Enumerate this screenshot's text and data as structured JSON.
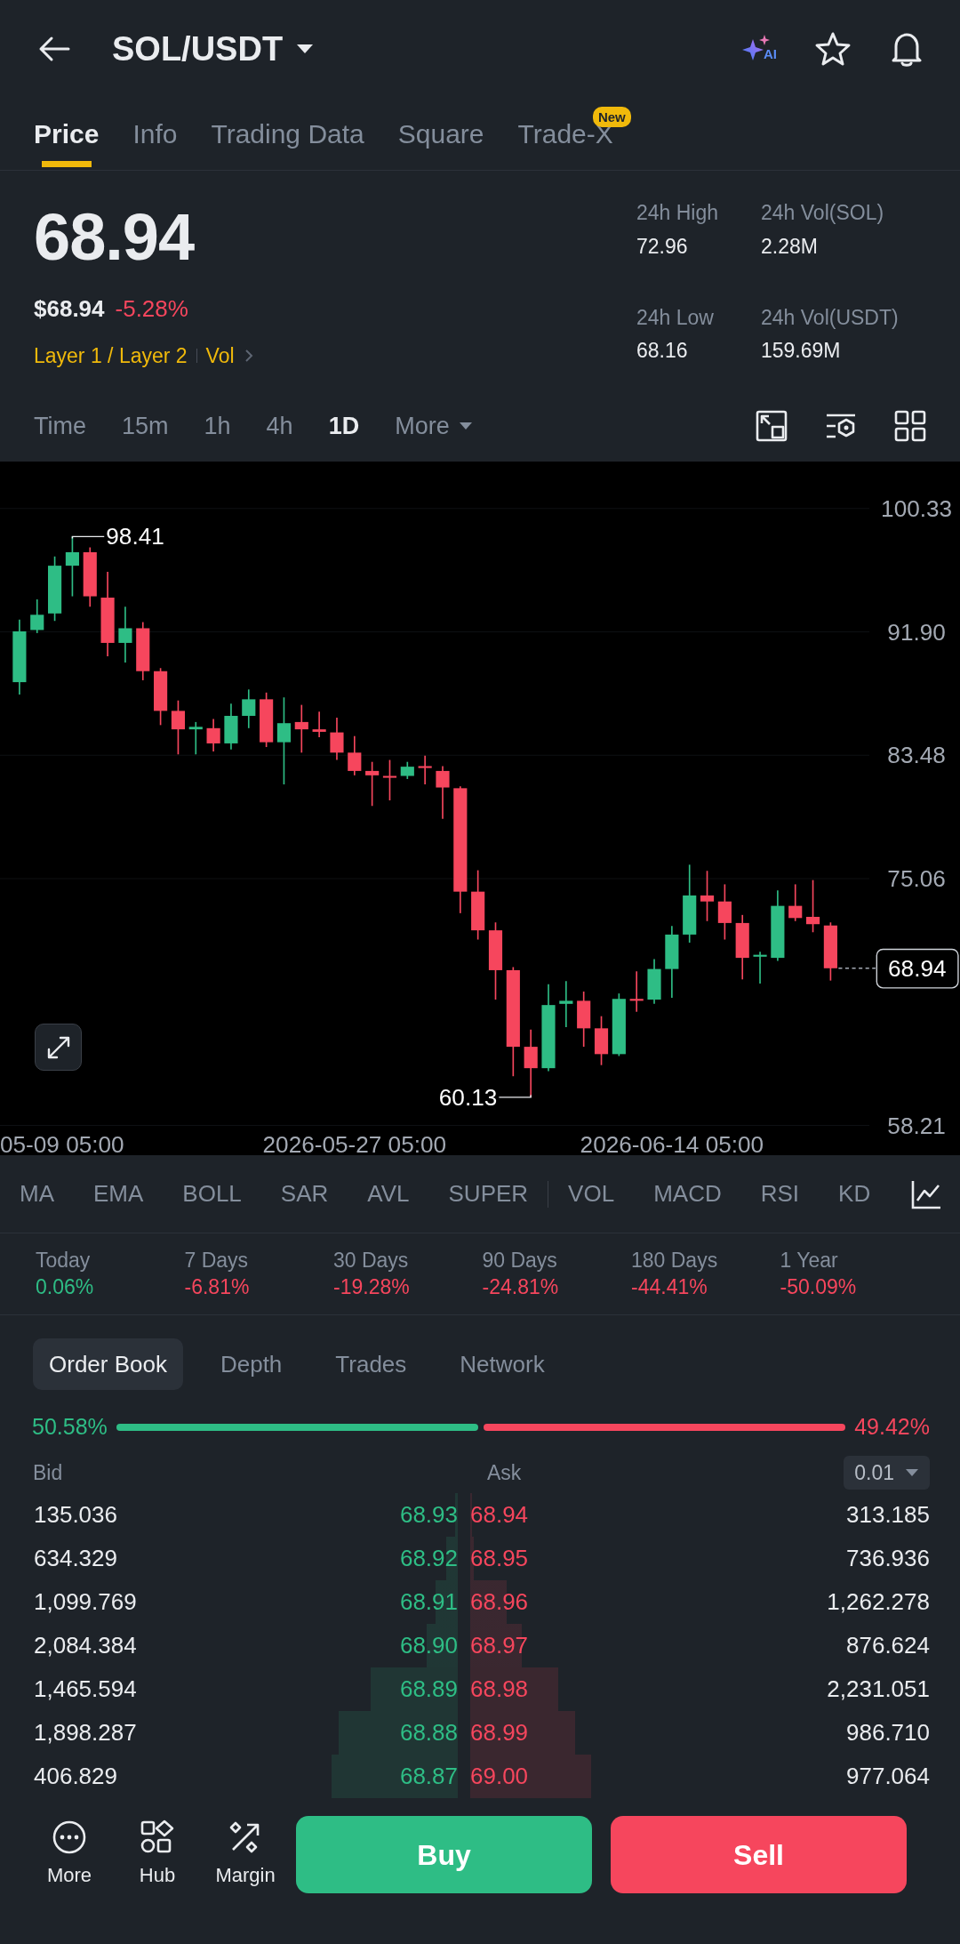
{
  "header": {
    "title": "SOL/USDT",
    "ai_label": "AI"
  },
  "tabs": [
    {
      "label": "Price",
      "selected": true
    },
    {
      "label": "Info",
      "selected": false
    },
    {
      "label": "Trading Data",
      "selected": false
    },
    {
      "label": "Square",
      "selected": false
    },
    {
      "label": "Trade-X",
      "selected": false,
      "badge": "New"
    }
  ],
  "price": {
    "last": "68.94",
    "usd": "$68.94",
    "change": "-5.28%",
    "tags": [
      "Layer 1 / Layer 2",
      "Vol"
    ]
  },
  "stats": [
    {
      "label": "24h High",
      "value": "72.96"
    },
    {
      "label": "24h Vol(SOL)",
      "value": "2.28M"
    },
    {
      "label": "24h Low",
      "value": "68.16"
    },
    {
      "label": "24h Vol(USDT)",
      "value": "159.69M"
    }
  ],
  "intervals": [
    {
      "label": "Time",
      "selected": false,
      "kind": "plain"
    },
    {
      "label": "15m",
      "selected": false,
      "kind": "plain"
    },
    {
      "label": "1h",
      "selected": false,
      "kind": "plain"
    },
    {
      "label": "4h",
      "selected": false,
      "kind": "plain"
    },
    {
      "label": "1D",
      "selected": true,
      "kind": "plain"
    },
    {
      "label": "More",
      "selected": false,
      "kind": "dropdown"
    }
  ],
  "chart": {
    "edge_time_label": "05-09 05:00",
    "high_label": "98.41",
    "low_label": "60.13",
    "last_price": "68.94",
    "chart_data": {
      "type": "candlestick",
      "categories": [
        null,
        null,
        null,
        null,
        null,
        null,
        null,
        null,
        null,
        null,
        null,
        null,
        null,
        null,
        null,
        null,
        null,
        null,
        null,
        "2026-05-27 05:00",
        null,
        null,
        null,
        null,
        null,
        null,
        null,
        null,
        null,
        null,
        null,
        null,
        null,
        null,
        null,
        null,
        null,
        "2026-06-14 05:00",
        null,
        null,
        null,
        null,
        null,
        null,
        null,
        null,
        null
      ],
      "ohlc": [
        [
          88.47,
          92.74,
          87.63,
          91.94
        ],
        [
          92.03,
          94.12,
          91.82,
          93.07
        ],
        [
          93.16,
          97.05,
          92.65,
          96.42
        ],
        [
          96.42,
          98.41,
          94.33,
          97.34
        ],
        [
          97.34,
          97.67,
          93.62,
          94.33
        ],
        [
          94.24,
          96.0,
          90.23,
          91.15
        ],
        [
          91.15,
          93.62,
          89.81,
          92.15
        ],
        [
          92.15,
          92.57,
          88.6,
          89.22
        ],
        [
          89.22,
          89.43,
          85.54,
          86.51
        ],
        [
          86.51,
          87.22,
          83.54,
          85.25
        ],
        [
          85.25,
          85.75,
          83.54,
          85.42
        ],
        [
          85.33,
          85.96,
          83.74,
          84.29
        ],
        [
          84.29,
          87.01,
          83.87,
          86.17
        ],
        [
          86.17,
          87.97,
          85.33,
          87.3
        ],
        [
          87.3,
          87.76,
          84.04,
          84.37
        ],
        [
          84.37,
          87.43,
          81.49,
          85.67
        ],
        [
          85.75,
          86.92,
          83.66,
          85.25
        ],
        [
          85.25,
          86.46,
          84.71,
          85.08
        ],
        [
          85.04,
          86.05,
          83.16,
          83.66
        ],
        [
          83.66,
          84.79,
          82.11,
          82.41
        ],
        [
          82.41,
          83.03,
          80.02,
          82.11
        ],
        [
          82.07,
          83.16,
          80.4,
          81.95
        ],
        [
          82.07,
          83.03,
          81.86,
          82.7
        ],
        [
          82.74,
          83.45,
          81.49,
          82.61
        ],
        [
          82.41,
          82.74,
          79.14,
          81.28
        ],
        [
          81.23,
          81.36,
          72.7,
          74.17
        ],
        [
          74.17,
          75.63,
          70.9,
          71.53
        ],
        [
          71.53,
          72.07,
          66.8,
          68.81
        ],
        [
          68.81,
          69.02,
          61.57,
          63.58
        ],
        [
          63.58,
          64.75,
          60.13,
          62.12
        ],
        [
          62.12,
          67.85,
          61.91,
          66.43
        ],
        [
          66.51,
          68.06,
          64.92,
          66.72
        ],
        [
          66.72,
          67.35,
          63.58,
          64.84
        ],
        [
          64.84,
          65.67,
          62.33,
          63.08
        ],
        [
          63.08,
          67.22,
          62.95,
          66.85
        ],
        [
          66.85,
          68.73,
          65.97,
          66.72
        ],
        [
          66.8,
          69.56,
          66.51,
          68.89
        ],
        [
          68.89,
          71.82,
          66.93,
          71.24
        ],
        [
          71.24,
          76.01,
          70.69,
          73.91
        ],
        [
          73.91,
          75.59,
          72.16,
          73.5
        ],
        [
          73.5,
          74.67,
          70.9,
          72.03
        ],
        [
          72.03,
          72.58,
          68.18,
          69.65
        ],
        [
          69.73,
          70.07,
          67.89,
          69.86
        ],
        [
          69.65,
          74.25,
          69.44,
          73.2
        ],
        [
          73.2,
          74.67,
          72.16,
          72.37
        ],
        [
          72.45,
          74.96,
          71.4,
          71.95
        ],
        [
          71.86,
          72.07,
          68.1,
          68.94
        ]
      ],
      "ylim": [
        56.18,
        103.53
      ],
      "grid": true,
      "yticks": [
        {
          "value": 100.33,
          "label": "100.33"
        },
        {
          "value": 91.9,
          "label": "91.90"
        },
        {
          "value": 83.48,
          "label": "83.48"
        },
        {
          "value": 75.06,
          "label": "75.06"
        },
        {
          "value": 58.21,
          "label": "58.21"
        }
      ]
    }
  },
  "main_indicators": [
    "MA",
    "EMA",
    "BOLL",
    "SAR",
    "AVL",
    "SUPER"
  ],
  "sub_indicators": [
    "VOL",
    "MACD",
    "RSI",
    "KD"
  ],
  "performance": [
    {
      "period": "Today",
      "change": "0.06%",
      "color": "#2ebd85"
    },
    {
      "period": "7 Days",
      "change": "-6.81%",
      "color": "#f6465d"
    },
    {
      "period": "30 Days",
      "change": "-19.28%",
      "color": "#f6465d"
    },
    {
      "period": "90 Days",
      "change": "-24.81%",
      "color": "#f6465d"
    },
    {
      "period": "180 Days",
      "change": "-44.41%",
      "color": "#f6465d"
    },
    {
      "period": "1 Year",
      "change": "-50.09%",
      "color": "#f6465d"
    }
  ],
  "book_tabs": [
    {
      "label": "Order Book",
      "selected": true
    },
    {
      "label": "Depth",
      "selected": false
    },
    {
      "label": "Trades",
      "selected": false
    },
    {
      "label": "Network",
      "selected": false
    }
  ],
  "ratio": {
    "bid": "50.58%",
    "ask": "49.42%"
  },
  "book": {
    "bid_header": "Bid",
    "ask_header": "Ask",
    "precision": "0.01",
    "rows": [
      {
        "bid": {
          "qty": "135.036",
          "price": "68.93"
        },
        "ask": {
          "price": "68.94",
          "qty": "313.185"
        }
      },
      {
        "bid": {
          "qty": "634.329",
          "price": "68.92"
        },
        "ask": {
          "price": "68.95",
          "qty": "736.936"
        }
      },
      {
        "bid": {
          "qty": "1,099.769",
          "price": "68.91"
        },
        "ask": {
          "price": "68.96",
          "qty": "1,262.278"
        }
      },
      {
        "bid": {
          "qty": "2,084.384",
          "price": "68.90"
        },
        "ask": {
          "price": "68.97",
          "qty": "876.624"
        }
      },
      {
        "bid": {
          "qty": "1,465.594",
          "price": "68.89"
        },
        "ask": {
          "price": "68.98",
          "qty": "2,231.051"
        }
      },
      {
        "bid": {
          "qty": "1,898.287",
          "price": "68.88"
        },
        "ask": {
          "price": "68.99",
          "qty": "986.710"
        }
      },
      {
        "bid": {
          "qty": "406.829",
          "price": "68.87"
        },
        "ask": {
          "price": "69.00",
          "qty": "977.064"
        }
      }
    ]
  },
  "bottom_bar": {
    "tools": [
      {
        "label": "More",
        "kind": "more"
      },
      {
        "label": "Hub",
        "kind": "hub"
      },
      {
        "label": "Margin",
        "kind": "margin"
      }
    ],
    "buy": "Buy",
    "sell": "Sell"
  }
}
